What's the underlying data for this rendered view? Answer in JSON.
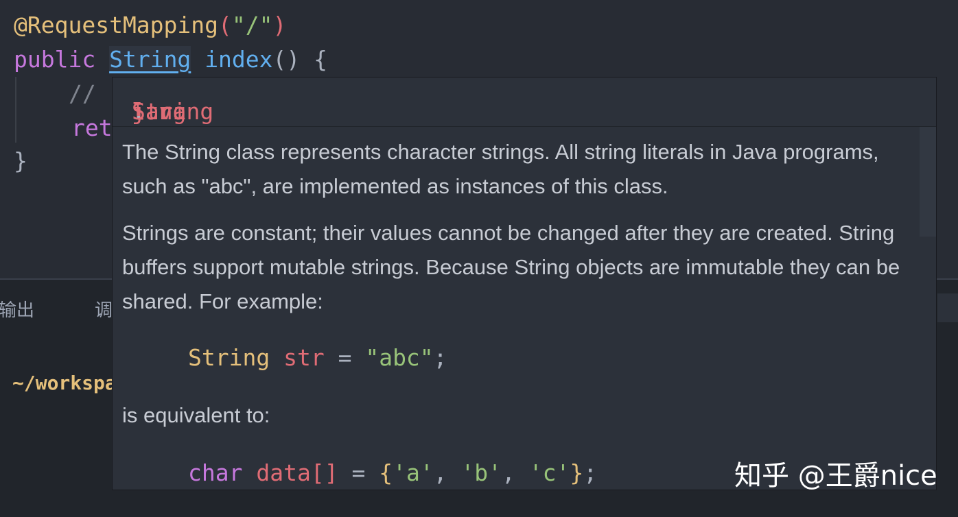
{
  "editor": {
    "line1": {
      "annotation": "@RequestMapping",
      "open_paren": "(",
      "arg": "\"/\"",
      "close_paren": ")"
    },
    "line2": {
      "modifier": "public",
      "type": "String",
      "method": "index",
      "parens": "()",
      "brace": "{"
    },
    "line3": {
      "comment": "//"
    },
    "line4": {
      "keyword_partial": "ret"
    },
    "line5": {
      "brace": "}"
    }
  },
  "panel": {
    "tab_output": "输出",
    "tab_debug_partial": "调",
    "terminal_path": "~/workspa"
  },
  "tooltip": {
    "header": {
      "pkg1": "java",
      "dot1": ".",
      "pkg2": "lang",
      "dot2": ".",
      "cls": "String"
    },
    "para1": "The String class represents character strings. All string literals in Java programs, such as \"abc\", are implemented as instances of this class.",
    "para2": "Strings are constant; their values cannot be changed after they are created. String buffers support mutable strings. Because String objects are immutable they can be shared. For example:",
    "code1": {
      "type": "String",
      "var": "str",
      "op": "=",
      "value": "\"abc\"",
      "semi": ";"
    },
    "para3": "is equivalent to:",
    "code2": {
      "type": "char",
      "var": "data[]",
      "op": "=",
      "open": "{",
      "a": "'a'",
      "comma1": ",",
      "b": "'b'",
      "comma2": ",",
      "c": "'c'",
      "close": "}",
      "semi": ";"
    }
  },
  "watermark": "知乎 @王爵nice",
  "colors": {
    "background": "#282c34",
    "tooltip_bg": "#2c313a",
    "keyword": "#c678dd",
    "function": "#61afef",
    "string": "#98c379",
    "annotation": "#e5c07b",
    "variable": "#e06c75"
  }
}
